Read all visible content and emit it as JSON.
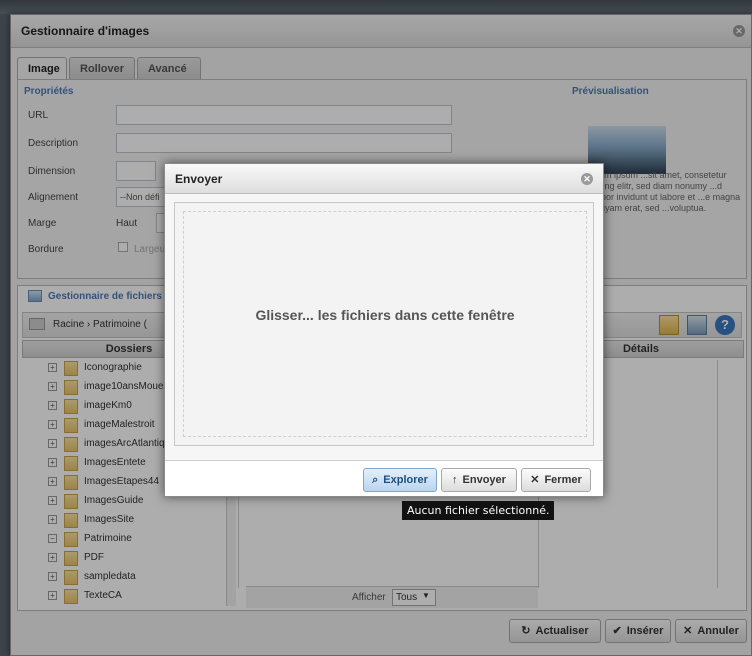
{
  "window": {
    "title": "Gestionnaire d'images",
    "tabs": [
      {
        "label": "Image",
        "active": true
      },
      {
        "label": "Rollover",
        "active": false
      },
      {
        "label": "Avancé",
        "active": false
      }
    ],
    "properties_title": "Propriétés",
    "preview_title": "Prévisualisation",
    "fields": {
      "url": "URL",
      "description": "Description",
      "dimension": "Dimension",
      "alignment": "Alignement",
      "alignment_value": "--Non défi",
      "margin": "Marge",
      "margin_top": "Haut",
      "border": "Bordure",
      "border_check": "Largeu"
    },
    "preview_text": "Lorem ipsum ...sit amet, consetetur ...scing elitr, sed diam nonumy ...d tempor invidunt ut labore et ...e magna aliquyam erat, sed ...voluptua."
  },
  "file_manager": {
    "title": "Gestionnaire de fichiers",
    "breadcrumb": "Racine › Patrimoine   (",
    "col_folders": "Dossiers",
    "col_details": "Détails",
    "folders": [
      {
        "name": "Iconographie",
        "expanded": false
      },
      {
        "name": "image10ansMouez",
        "expanded": false
      },
      {
        "name": "imageKm0",
        "expanded": false
      },
      {
        "name": "imageMalestroit",
        "expanded": false
      },
      {
        "name": "imagesArcAtlantique",
        "expanded": false
      },
      {
        "name": "ImagesEntete",
        "expanded": false
      },
      {
        "name": "ImagesEtapes44",
        "expanded": false
      },
      {
        "name": "ImagesGuide",
        "expanded": false
      },
      {
        "name": "ImagesSite",
        "expanded": false
      },
      {
        "name": "Patrimoine",
        "expanded": true
      },
      {
        "name": "PDF",
        "expanded": false
      },
      {
        "name": "sampledata",
        "expanded": false
      },
      {
        "name": "TexteCA",
        "expanded": false
      }
    ],
    "show_label": "Afficher",
    "show_value": "Tous"
  },
  "footer_buttons": {
    "refresh": "Actualiser",
    "insert": "Insérer",
    "cancel": "Annuler"
  },
  "upload_dialog": {
    "title": "Envoyer",
    "drop_text": "Glisser...    les fichiers dans cette fenêtre",
    "browse": "Explorer",
    "upload": "Envoyer",
    "close": "Fermer"
  },
  "tooltip": "Aucun fichier sélectionné."
}
